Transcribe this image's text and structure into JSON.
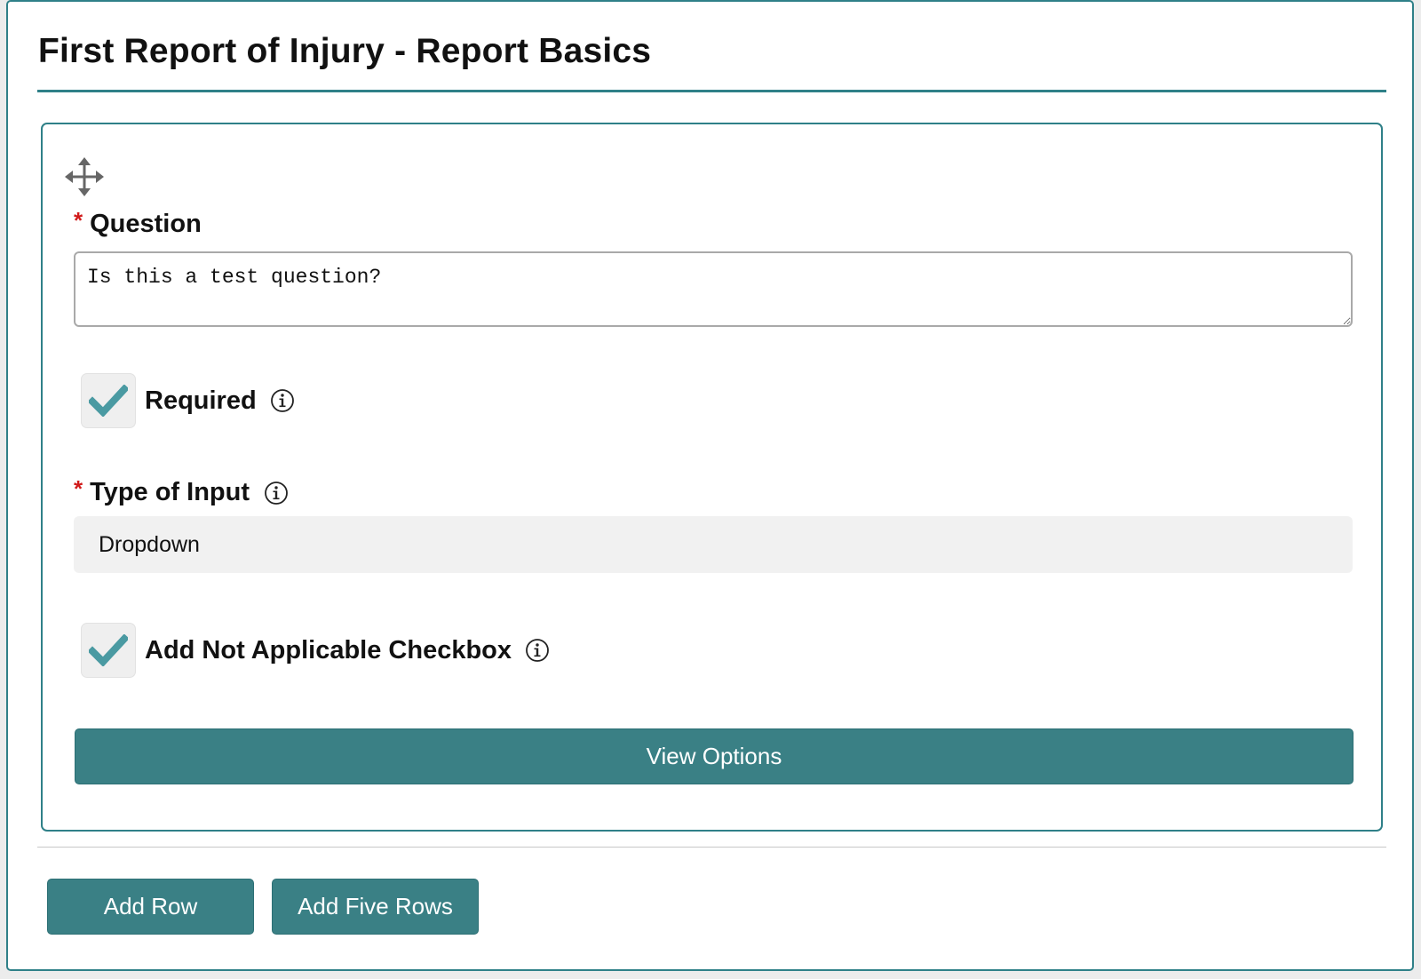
{
  "page": {
    "title": "First Report of Injury - Report Basics"
  },
  "question_card": {
    "question": {
      "required_marker": "*",
      "label": "Question",
      "value": "Is this a test question?"
    },
    "required": {
      "label": "Required",
      "checked": true,
      "icon": "info-icon"
    },
    "type_of_input": {
      "required_marker": "*",
      "label": "Type of Input",
      "selected": "Dropdown",
      "icon": "info-icon"
    },
    "not_applicable": {
      "label": "Add Not Applicable Checkbox",
      "checked": true,
      "icon": "info-icon"
    },
    "view_options_label": "View Options"
  },
  "actions": {
    "add_row_label": "Add Row",
    "add_five_rows_label": "Add Five Rows"
  },
  "colors": {
    "accent": "#3a8085",
    "border": "#2f8088",
    "checkmark": "#4a9aa2",
    "required_star": "#d11a1a"
  }
}
